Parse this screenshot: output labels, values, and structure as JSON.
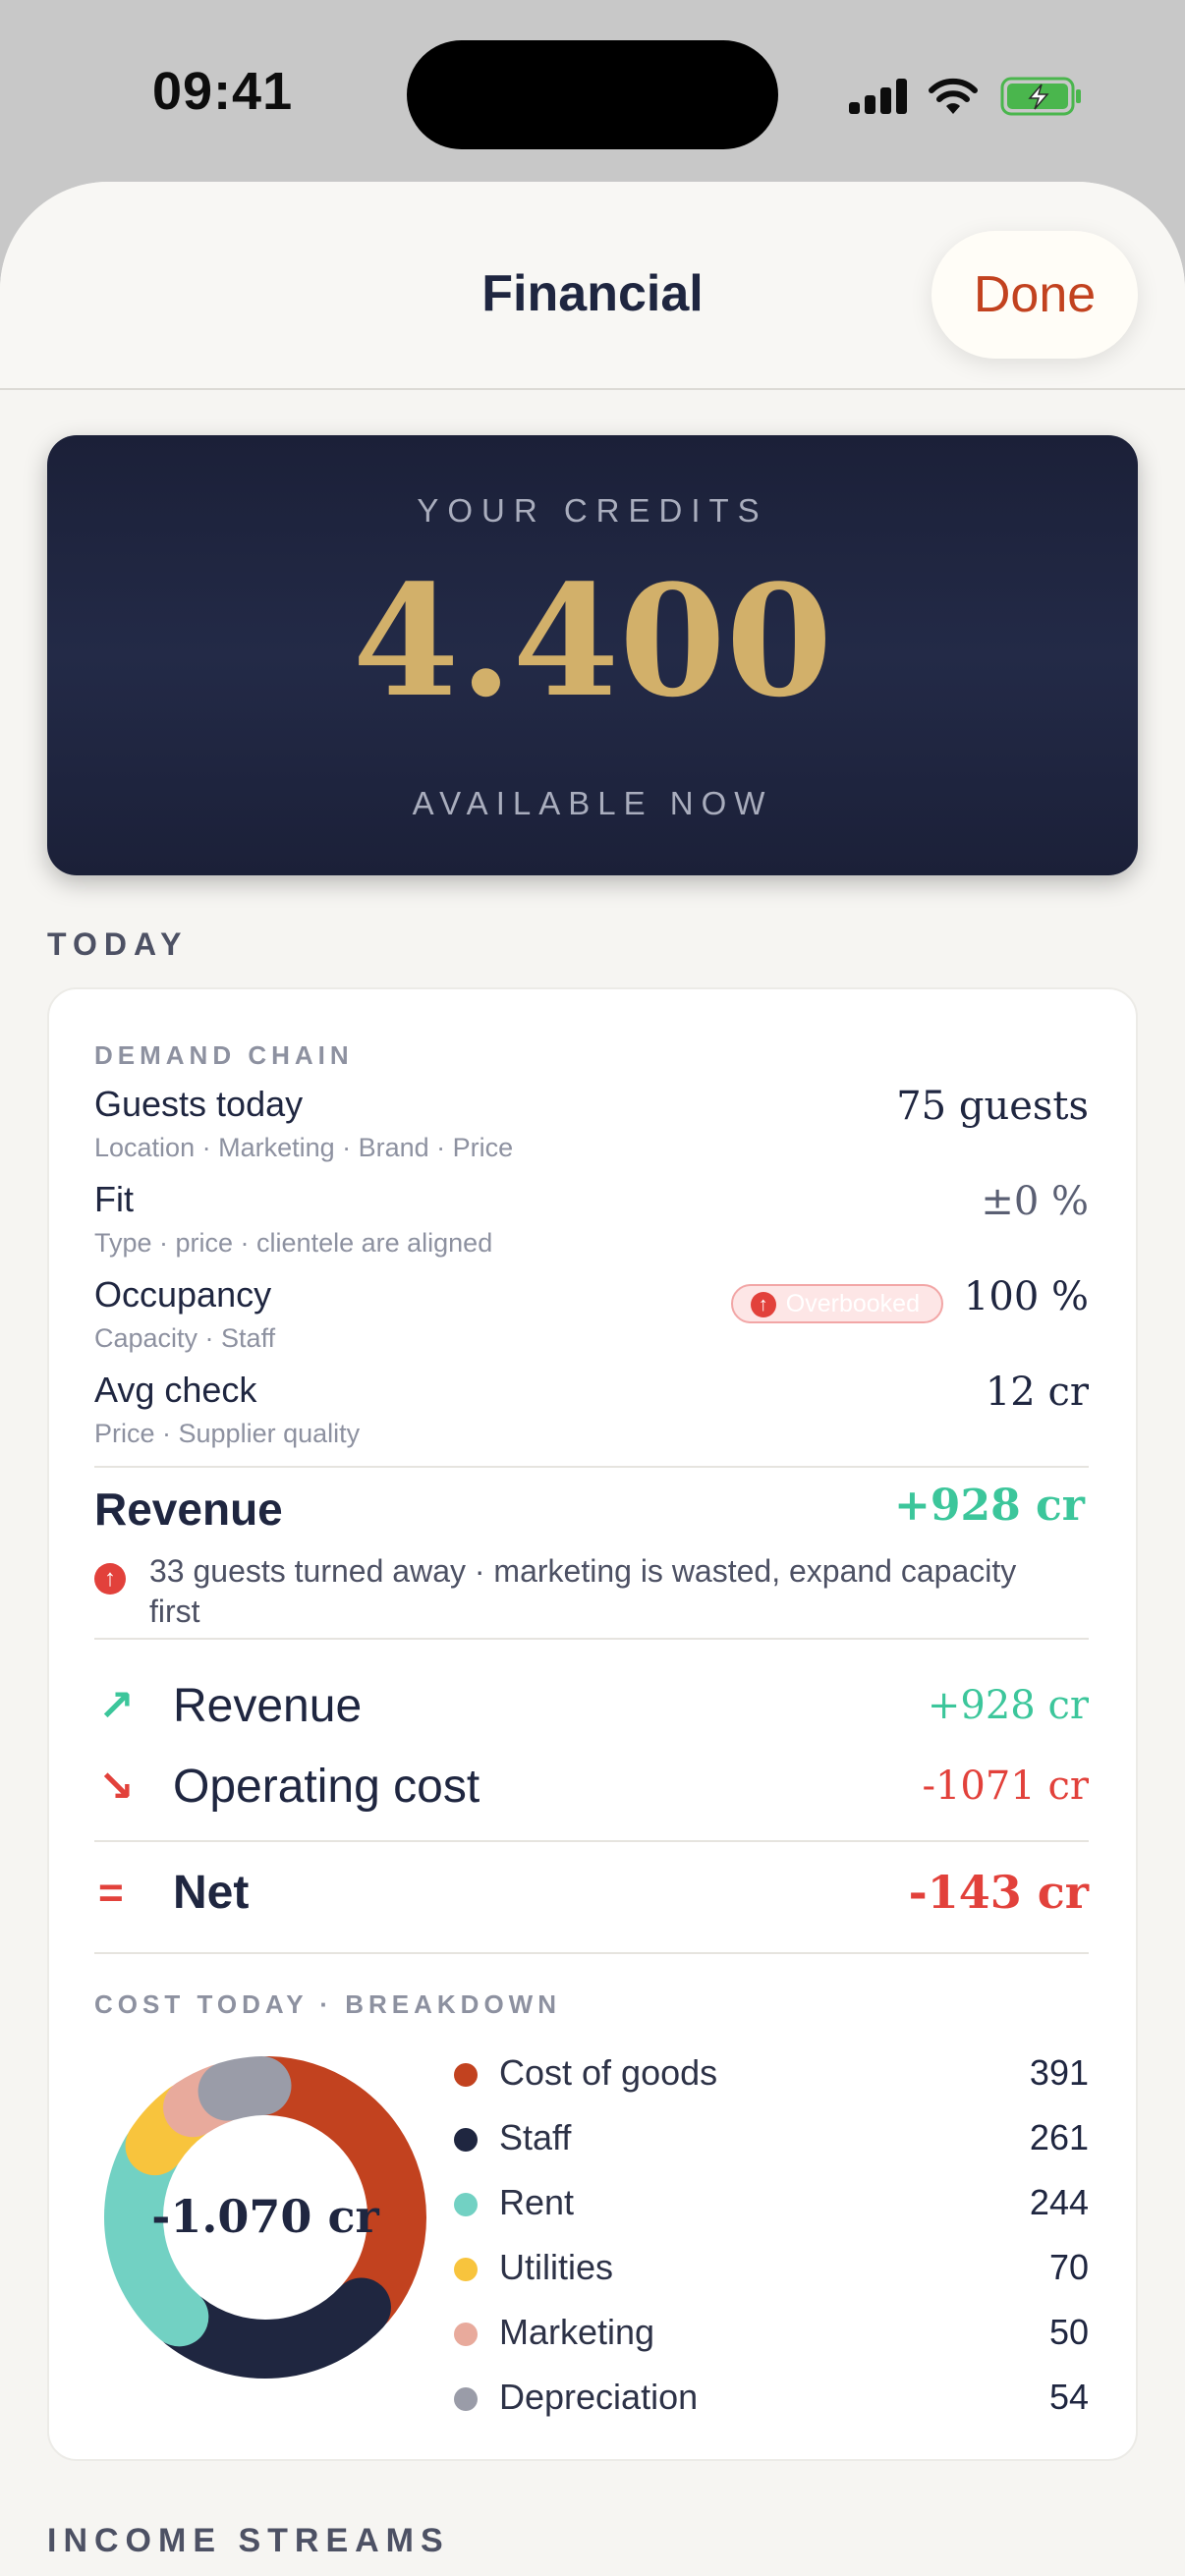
{
  "status_bar": {
    "time": "09:41"
  },
  "header": {
    "title": "Financial",
    "done_label": "Done"
  },
  "credits": {
    "label": "YOUR CREDITS",
    "value": "4.400",
    "sublabel": "AVAILABLE NOW"
  },
  "today": {
    "section_label": "TODAY",
    "demand_chain_label": "DEMAND CHAIN",
    "chain": [
      {
        "name": "Guests today",
        "sub": "Location · Marketing · Brand · Price",
        "value": "75 guests"
      },
      {
        "name": "Fit",
        "sub": "Type · price · clientele are aligned",
        "value": "±0 %"
      },
      {
        "name": "Occupancy",
        "sub": "Capacity · Staff",
        "value": "100 %",
        "badge": "Overbooked"
      },
      {
        "name": "Avg check",
        "sub": "Price · Supplier quality",
        "value": "12 cr"
      }
    ],
    "revenue": {
      "title": "Revenue",
      "value": "+928 cr",
      "warning": "33 guests turned away · marketing is wasted, expand capacity first"
    },
    "flows": [
      {
        "icon": "arrow-up-right-icon",
        "label": "Revenue",
        "value": "+928 cr"
      },
      {
        "icon": "arrow-down-right-icon",
        "label": "Operating cost",
        "value": "-1071 cr"
      },
      {
        "icon": "equals-icon",
        "label": "Net",
        "value": "-143 cr"
      }
    ],
    "breakdown": {
      "label": "COST TODAY · BREAKDOWN",
      "center": "-1.070 cr",
      "items": [
        {
          "label": "Cost of goods",
          "value": "391",
          "color": "#c2421f"
        },
        {
          "label": "Staff",
          "value": "261",
          "color": "#1f2640"
        },
        {
          "label": "Rent",
          "value": "244",
          "color": "#72d1c3"
        },
        {
          "label": "Utilities",
          "value": "70",
          "color": "#f8c43d"
        },
        {
          "label": "Marketing",
          "value": "50",
          "color": "#e8aa9c"
        },
        {
          "label": "Depreciation",
          "value": "54",
          "color": "#9a9ca8"
        }
      ]
    }
  },
  "chart_data": {
    "type": "pie",
    "title": "COST TODAY · BREAKDOWN",
    "center_label": "-1.070 cr",
    "categories": [
      "Cost of goods",
      "Staff",
      "Rent",
      "Utilities",
      "Marketing",
      "Depreciation"
    ],
    "values": [
      391,
      261,
      244,
      70,
      50,
      54
    ],
    "colors": [
      "#c2421f",
      "#1f2640",
      "#72d1c3",
      "#f8c43d",
      "#e8aa9c",
      "#9a9ca8"
    ],
    "style": "donut"
  },
  "income_streams": {
    "section_label": "INCOME STREAMS"
  }
}
